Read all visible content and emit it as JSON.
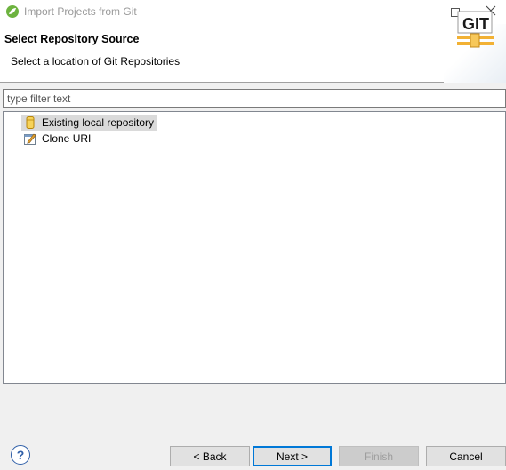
{
  "window": {
    "title": "Import Projects from Git",
    "app_icon": "eclipse-spring-icon",
    "controls": [
      "minimize-icon",
      "maximize-icon",
      "close-icon"
    ]
  },
  "banner": {
    "title": "Select Repository Source",
    "description": "Select a location of Git Repositories",
    "logo_text": "GIT"
  },
  "filter": {
    "value": "",
    "placeholder": "type filter text"
  },
  "tree": {
    "items": [
      {
        "label": "Existing local repository",
        "icon": "git-repository-icon",
        "selected": true
      },
      {
        "label": "Clone URI",
        "icon": "clone-uri-icon",
        "selected": false
      }
    ]
  },
  "buttons": {
    "help": "?",
    "back": "< Back",
    "next": "Next >",
    "finish": "Finish",
    "cancel": "Cancel"
  },
  "colors": {
    "accent": "#0078d7",
    "selection": "#dadada",
    "disabled_text": "#9e9e9e"
  }
}
